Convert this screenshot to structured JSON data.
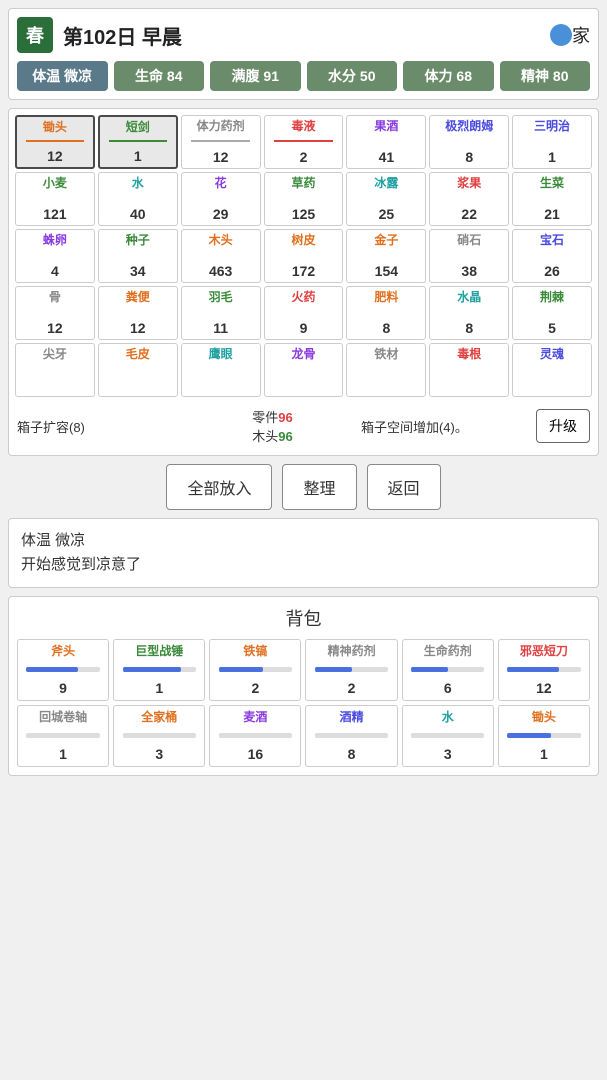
{
  "header": {
    "season": "春",
    "day": "第102日 早晨",
    "home_label": "家",
    "stats": [
      {
        "label": "体温 微凉",
        "highlighted": true
      },
      {
        "label": "生命 84"
      },
      {
        "label": "满腹 91"
      },
      {
        "label": "水分 50"
      },
      {
        "label": "体力 68"
      },
      {
        "label": "精神 80"
      }
    ]
  },
  "inventory": {
    "grid": [
      {
        "name": "锄头",
        "count": "12",
        "name_color": "orange",
        "underline": "orange",
        "selected": true
      },
      {
        "name": "短剑",
        "count": "1",
        "name_color": "green",
        "underline": "green",
        "selected": true
      },
      {
        "name": "体力药剂",
        "count": "12",
        "name_color": "gray",
        "underline": "gray"
      },
      {
        "name": "毒液",
        "count": "2",
        "name_color": "red",
        "underline": "red"
      },
      {
        "name": "果酒",
        "count": "41",
        "name_color": "purple",
        "underline": ""
      },
      {
        "name": "极烈朗姆",
        "count": "8",
        "name_color": "blue",
        "underline": ""
      },
      {
        "name": "三明治",
        "count": "1",
        "name_color": "blue",
        "underline": ""
      },
      {
        "name": "小麦",
        "count": "121",
        "name_color": "green",
        "underline": ""
      },
      {
        "name": "水",
        "count": "40",
        "name_color": "teal",
        "underline": ""
      },
      {
        "name": "花",
        "count": "29",
        "name_color": "purple",
        "underline": ""
      },
      {
        "name": "草药",
        "count": "125",
        "name_color": "green",
        "underline": ""
      },
      {
        "name": "冰露",
        "count": "25",
        "name_color": "teal",
        "underline": ""
      },
      {
        "name": "浆果",
        "count": "22",
        "name_color": "red",
        "underline": ""
      },
      {
        "name": "生菜",
        "count": "21",
        "name_color": "green",
        "underline": ""
      },
      {
        "name": "蛛卵",
        "count": "4",
        "name_color": "purple",
        "underline": ""
      },
      {
        "name": "种子",
        "count": "34",
        "name_color": "green",
        "underline": ""
      },
      {
        "name": "木头",
        "count": "463",
        "name_color": "orange",
        "underline": ""
      },
      {
        "name": "树皮",
        "count": "172",
        "name_color": "orange",
        "underline": ""
      },
      {
        "name": "金子",
        "count": "154",
        "name_color": "orange",
        "underline": ""
      },
      {
        "name": "硝石",
        "count": "38",
        "name_color": "gray",
        "underline": ""
      },
      {
        "name": "宝石",
        "count": "26",
        "name_color": "blue",
        "underline": ""
      },
      {
        "name": "骨",
        "count": "12",
        "name_color": "gray",
        "underline": ""
      },
      {
        "name": "粪便",
        "count": "12",
        "name_color": "orange",
        "underline": ""
      },
      {
        "name": "羽毛",
        "count": "11",
        "name_color": "green",
        "underline": ""
      },
      {
        "name": "火药",
        "count": "9",
        "name_color": "red",
        "underline": ""
      },
      {
        "name": "肥料",
        "count": "8",
        "name_color": "orange",
        "underline": ""
      },
      {
        "name": "水晶",
        "count": "8",
        "name_color": "teal",
        "underline": ""
      },
      {
        "name": "荆棘",
        "count": "5",
        "name_color": "green",
        "underline": ""
      },
      {
        "name": "尖牙",
        "count": "",
        "name_color": "gray",
        "underline": ""
      },
      {
        "name": "毛皮",
        "count": "",
        "name_color": "orange",
        "underline": ""
      },
      {
        "name": "鹰眼",
        "count": "",
        "name_color": "teal",
        "underline": ""
      },
      {
        "name": "龙骨",
        "count": "",
        "name_color": "purple",
        "underline": ""
      },
      {
        "name": "铁材",
        "count": "",
        "name_color": "gray",
        "underline": ""
      },
      {
        "name": "毒根",
        "count": "",
        "name_color": "red",
        "underline": ""
      },
      {
        "name": "灵魂",
        "count": "",
        "name_color": "blue",
        "underline": ""
      }
    ],
    "box_expand": "箱子扩容(8)",
    "parts_label": "零件",
    "parts_count": "96",
    "wood_label": "木头",
    "wood_count": "96",
    "space_info": "箱子空间增加(4)。",
    "upgrade_btn": "升级"
  },
  "actions": {
    "put_all": "全部放入",
    "organize": "整理",
    "back": "返回"
  },
  "message": {
    "line1": "体温 微凉",
    "line2": "开始感觉到凉意了"
  },
  "backpack": {
    "title": "背包",
    "items": [
      {
        "name": "斧头",
        "count": "9",
        "name_color": "orange",
        "bar": 70
      },
      {
        "name": "巨型战锤",
        "count": "1",
        "name_color": "green",
        "bar": 80
      },
      {
        "name": "铁镐",
        "count": "2",
        "name_color": "orange",
        "bar": 60
      },
      {
        "name": "精神药剂",
        "count": "2",
        "name_color": "gray",
        "bar": 50
      },
      {
        "name": "生命药剂",
        "count": "6",
        "name_color": "gray",
        "bar": 50
      },
      {
        "name": "邪恶短刀",
        "count": "12",
        "name_color": "red",
        "bar": 70
      },
      {
        "name": "回城卷轴",
        "count": "1",
        "name_color": "gray",
        "bar": 0
      },
      {
        "name": "全家桶",
        "count": "3",
        "name_color": "orange",
        "bar": 0
      },
      {
        "name": "麦酒",
        "count": "16",
        "name_color": "purple",
        "bar": 0
      },
      {
        "name": "酒精",
        "count": "8",
        "name_color": "blue",
        "bar": 0
      },
      {
        "name": "水",
        "count": "3",
        "name_color": "teal",
        "bar": 0
      },
      {
        "name": "锄头",
        "count": "1",
        "name_color": "orange",
        "bar": 60
      }
    ]
  }
}
